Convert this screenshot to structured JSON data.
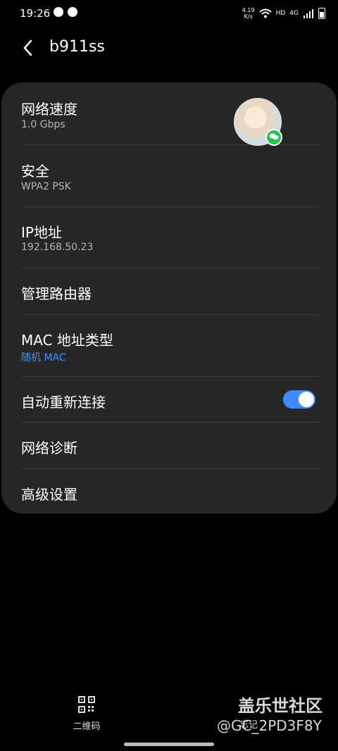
{
  "status_bar": {
    "time": "19:26",
    "speed_value": "4.19",
    "speed_unit": "K/s",
    "hd": "HD",
    "network": "4G"
  },
  "header": {
    "title": "b911ss"
  },
  "settings": {
    "network_speed": {
      "label": "网络速度",
      "value": "1.0 Gbps"
    },
    "security": {
      "label": "安全",
      "value": "WPA2 PSK"
    },
    "ip_address": {
      "label": "IP地址",
      "value": "192.168.50.23"
    },
    "manage_router": {
      "label": "管理路由器"
    },
    "mac_address_type": {
      "label": "MAC 地址类型",
      "value": "随机 MAC"
    },
    "auto_reconnect": {
      "label": "自动重新连接",
      "enabled": true
    },
    "network_diagnosis": {
      "label": "网络诊断"
    },
    "advanced_settings": {
      "label": "高级设置"
    }
  },
  "bottom": {
    "qr_label": "二维码",
    "other_label": "忘记"
  },
  "watermark": {
    "line1": "盖乐世社区",
    "line2": "@GC_2PD3F8Y"
  },
  "colors": {
    "accent": "#3e8bff",
    "card_bg": "#262626"
  }
}
